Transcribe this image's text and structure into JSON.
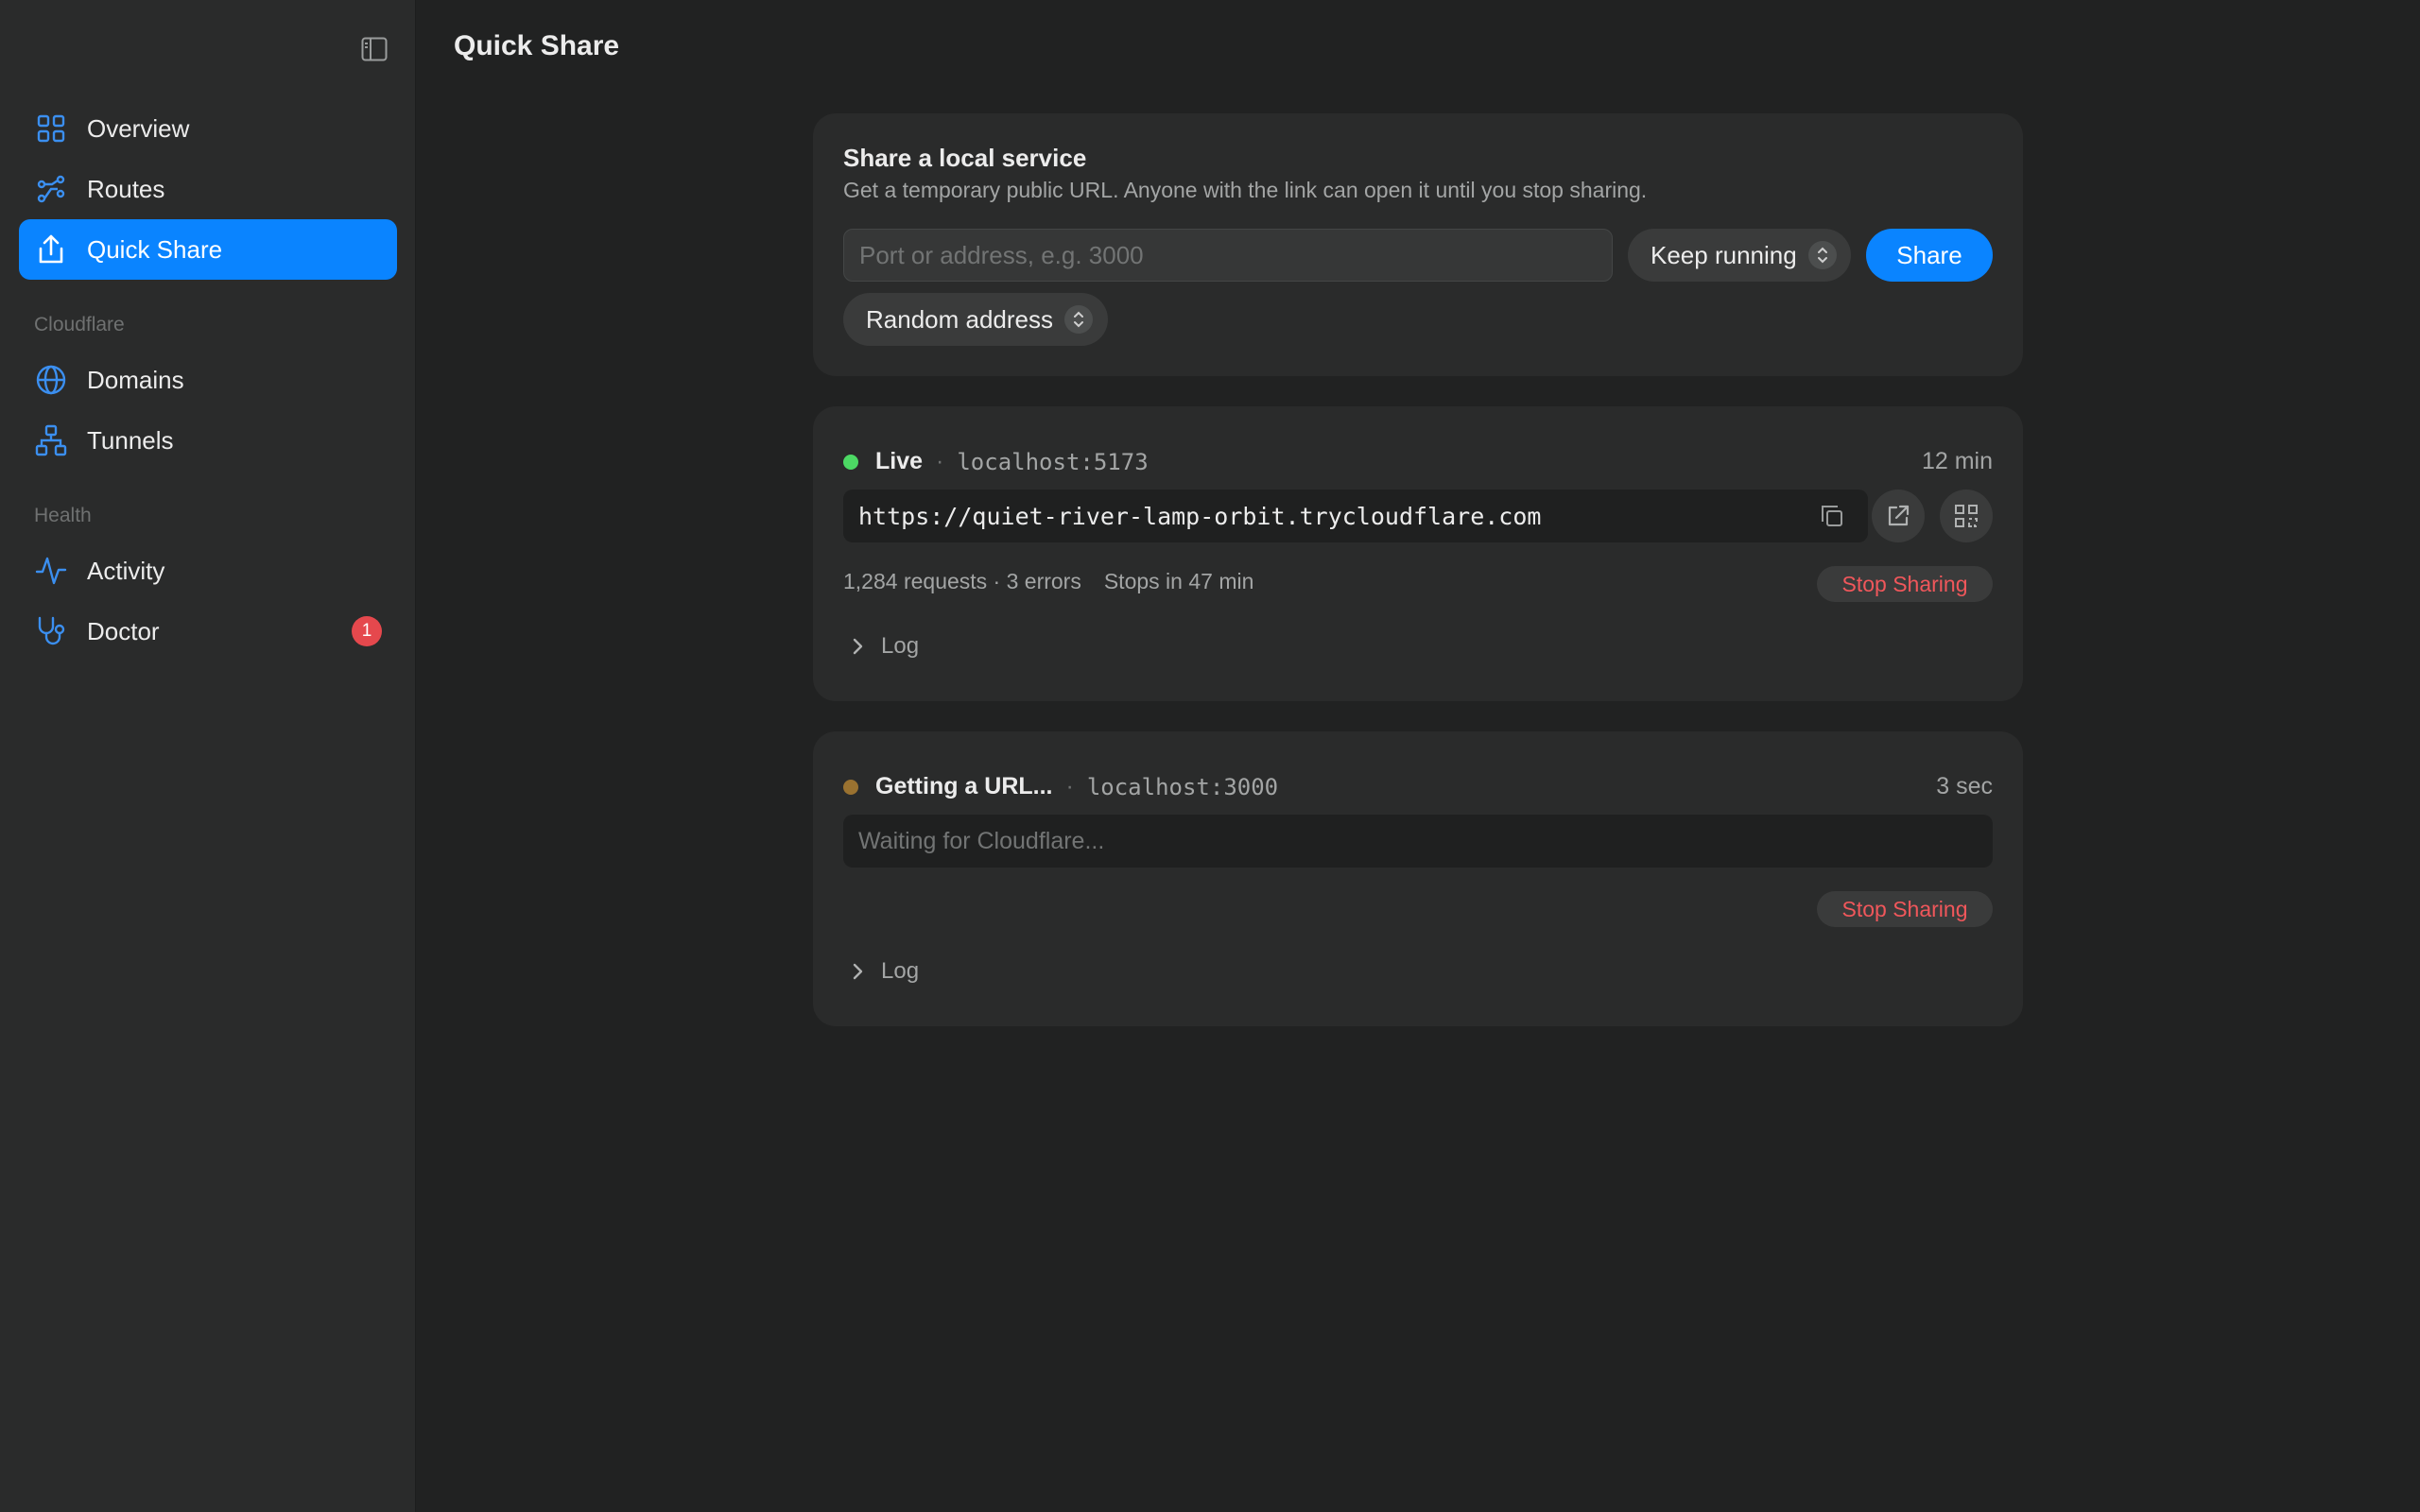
{
  "colors": {
    "accent": "#0a84ff",
    "live": "#4cd964",
    "pending": "#9a7230",
    "danger": "#f0575b",
    "badge": "#e5484d"
  },
  "sidebar": {
    "toggle_icon": "sidebar-toggle-icon",
    "items": [
      {
        "label": "Overview",
        "icon": "grid-icon"
      },
      {
        "label": "Routes",
        "icon": "routes-icon"
      },
      {
        "label": "Quick Share",
        "icon": "share-icon",
        "active": true
      }
    ],
    "sections": [
      {
        "title": "Cloudflare",
        "items": [
          {
            "label": "Domains",
            "icon": "globe-icon"
          },
          {
            "label": "Tunnels",
            "icon": "network-icon"
          }
        ]
      },
      {
        "title": "Health",
        "items": [
          {
            "label": "Activity",
            "icon": "activity-icon"
          },
          {
            "label": "Doctor",
            "icon": "stethoscope-icon",
            "badge": "1"
          }
        ]
      }
    ]
  },
  "page": {
    "title": "Quick Share"
  },
  "share_form": {
    "title": "Share a local service",
    "subtitle": "Get a temporary public URL. Anyone with the link can open it until you stop sharing.",
    "input_placeholder": "Port or address, e.g. 3000",
    "input_value": "",
    "duration_select": "Keep running",
    "share_button": "Share",
    "address_select": "Random address"
  },
  "shares": [
    {
      "status": "Live",
      "host": "localhost:5173",
      "elapsed": "12 min",
      "url": "https://quiet-river-lamp-orbit.trycloudflare.com",
      "stats": "1,284 requests · 3 errors",
      "stops": "Stops in 47 min",
      "stop_button": "Stop Sharing",
      "log_label": "Log"
    },
    {
      "status": "Getting a URL...",
      "host": "localhost:3000",
      "elapsed": "3 sec",
      "waiting_text": "Waiting for Cloudflare...",
      "stop_button": "Stop Sharing",
      "log_label": "Log"
    }
  ]
}
